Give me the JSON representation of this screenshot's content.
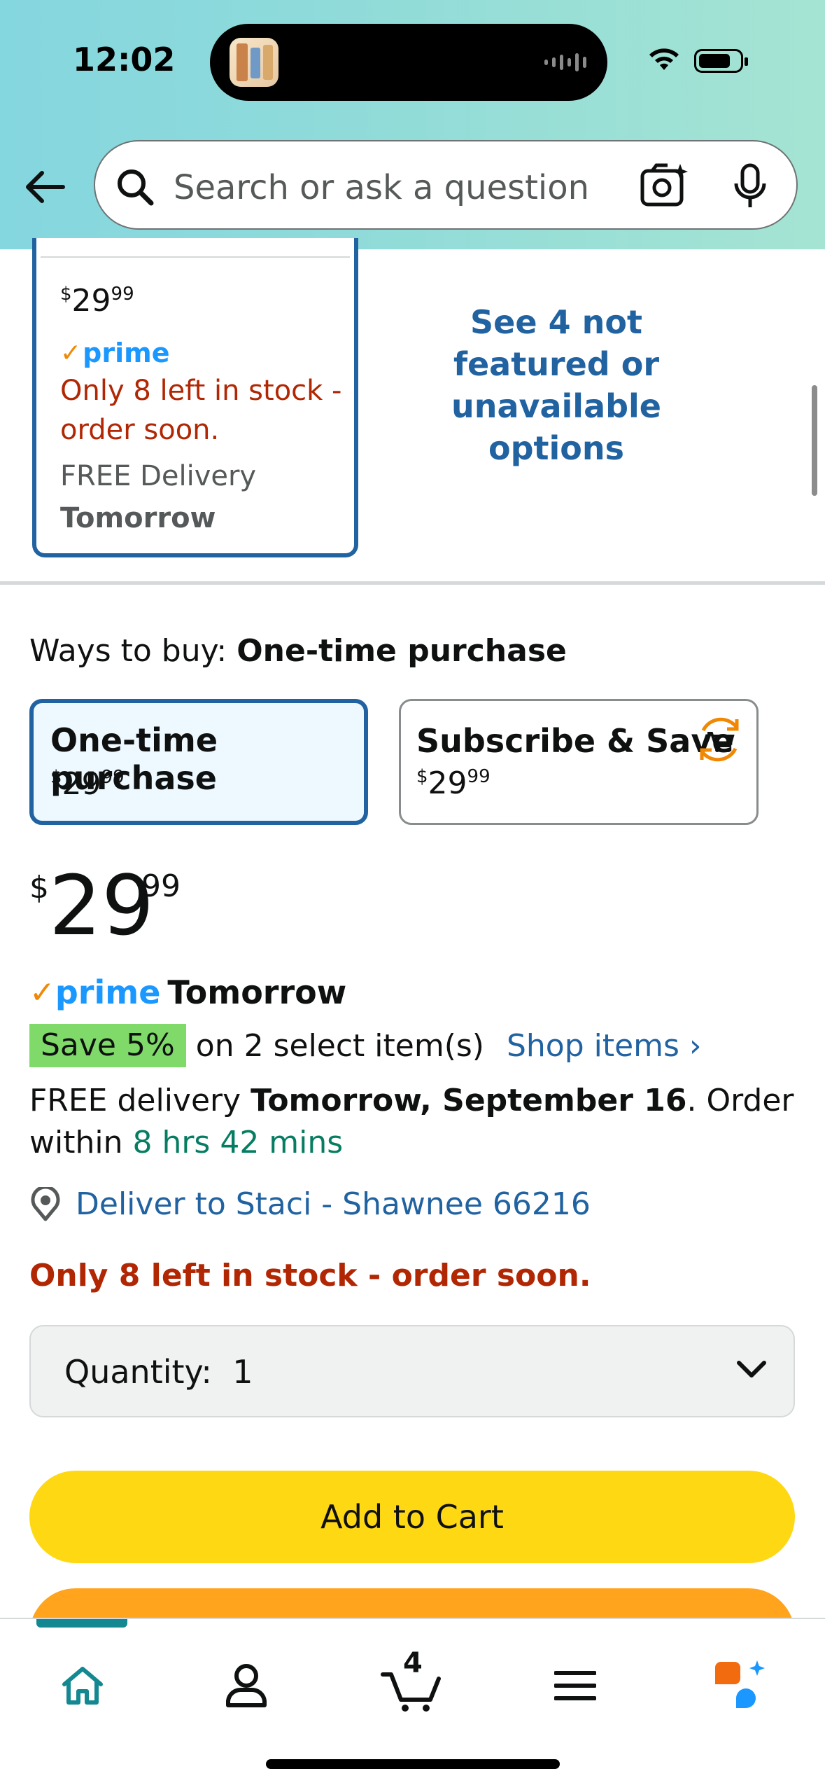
{
  "status_bar": {
    "time": "12:02"
  },
  "search": {
    "placeholder": "Search or ask a question"
  },
  "product_card": {
    "price_whole": "29",
    "price_fraction": "99",
    "currency": "$",
    "prime_label": "prime",
    "stock_text": "Only 8 left in stock - order soon.",
    "delivery_label": "FREE Delivery",
    "delivery_day": "Tomorrow"
  },
  "not_featured_link": "See 4 not featured or unavailable options",
  "ways_to_buy": {
    "label": "Ways to buy:",
    "selected": "One-time purchase"
  },
  "purchase_options": [
    {
      "title": "One-time purchase",
      "currency": "$",
      "whole": "29",
      "fraction": "99"
    },
    {
      "title": "Subscribe & Save",
      "currency": "$",
      "whole": "29",
      "fraction": "99"
    }
  ],
  "main_price": {
    "currency": "$",
    "whole": "29",
    "fraction": "99"
  },
  "prime_delivery": {
    "prime_label": "prime",
    "day": "Tomorrow"
  },
  "promo": {
    "badge": "Save 5%",
    "text": "on 2 select item(s)",
    "link": "Shop items ›"
  },
  "delivery": {
    "prefix": "FREE delivery",
    "date": "Tomorrow, September 16",
    "middle": ". Order within",
    "countdown": "8 hrs 42 mins"
  },
  "deliver_to": "Deliver to Staci - Shawnee 66216",
  "stock_warning": "Only 8 left in stock - order soon.",
  "quantity": {
    "label": "Quantity:",
    "value": "1"
  },
  "add_to_cart_label": "Add to Cart",
  "cart": {
    "count": "4"
  },
  "colors": {
    "link_blue": "#2162a1",
    "stock_red": "#b12704",
    "green": "#067d62",
    "add_to_cart_yellow": "#ffd814",
    "buy_now_orange": "#ffa41c",
    "prime_blue": "#1a98ff",
    "teal_accent": "#148891"
  }
}
